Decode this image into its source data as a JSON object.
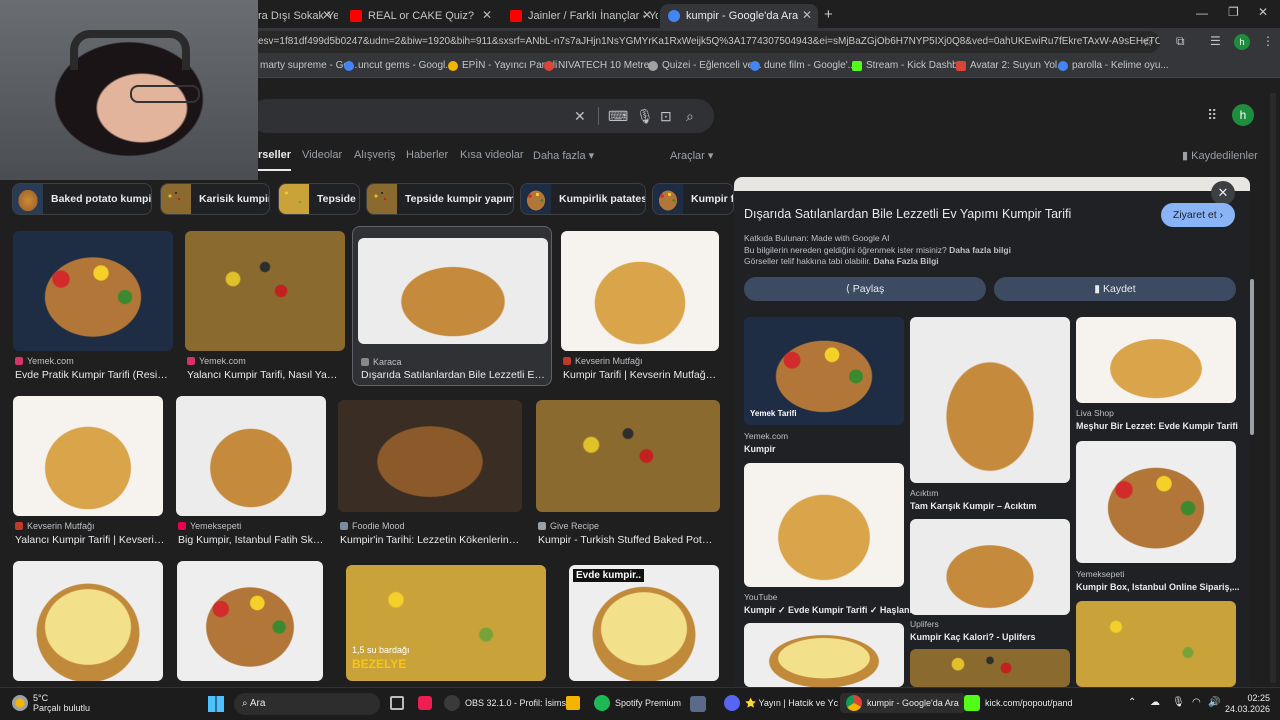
{
  "browser": {
    "tabs": [
      {
        "label": "ra Dışı Sokak Ye",
        "icon_color": "#ff0000"
      },
      {
        "label": "REAL or CAKE Quiz?",
        "icon_color": "#ff0000"
      },
      {
        "label": "Jainler / Farklı İnançlar - YouTube",
        "icon_color": "#ff0000"
      },
      {
        "label": "kumpir - Google'da Ara",
        "icon_color": "#4285f4"
      }
    ],
    "new_tab": "+",
    "url": "esv=1f81df499d5b0247&udm=2&biw=1920&bih=911&sxsrf=ANbL-n7s7aJHjn1NsYGMYrKa1RxWeijk5Q%3A1774307504943&ei=sMjBaZGjOb6H7NYP5IXj0Q8&ved=0ahUKEwiRu7fEkreTAxW-A9sEHeTCPoQ4dU...",
    "profile": "h",
    "bookmarks": [
      {
        "label": "marty supreme - Go...",
        "color": "#4285f4"
      },
      {
        "label": "uncut gems - Googl...",
        "color": "#4285f4"
      },
      {
        "label": "EPİN - Yayıncı Paneli",
        "color": "#f4b400"
      },
      {
        "label": "NIVATECH 10 Metre...",
        "color": "#db4437"
      },
      {
        "label": "Quizei - Eğlenceli ve...",
        "color": "#a0a0a0"
      },
      {
        "label": "dune film - Google'...",
        "color": "#4285f4"
      },
      {
        "label": "Stream - Kick Dashb...",
        "color": "#53fc18"
      },
      {
        "label": "Avatar 2: Suyun Yol...",
        "color": "#db4437"
      },
      {
        "label": "parolla - Kelime oyu...",
        "color": "#4285f4"
      }
    ]
  },
  "google": {
    "profile": "h",
    "nav": [
      "rseller",
      "Videolar",
      "Alışveriş",
      "Haberler",
      "Kısa videolar",
      "Daha fazla",
      "Araçlar",
      "Kaydedilenler"
    ],
    "chips": [
      "Baked potato kumpir",
      "Karisik kumpir",
      "Tepside",
      "Tepside kumpir yapımı",
      "Kumpirlik patates",
      "Kumpir fi"
    ],
    "results": [
      {
        "source": "Yemek.com",
        "title": "Evde Pratik Kumpir Tarifi (Resimli...",
        "fav": "#d6336c"
      },
      {
        "source": "Yemek.com",
        "title": "Yalancı Kumpir Tarifi, Nasıl Yapılı...",
        "fav": "#d6336c"
      },
      {
        "source": "Karaca",
        "title": "Dışarıda Satılanlardan Bile Lezzetli Ev Y...",
        "fav": "#888888"
      },
      {
        "source": "Kevserin Mutfağı",
        "title": "Kumpir Tarifi | Kevserin Mutfağı - ...",
        "fav": "#c0392b"
      },
      {
        "source": "Kevserin Mutfağı",
        "title": "Yalancı Kumpir Tarifi | Kevserin...",
        "fav": "#c0392b"
      },
      {
        "source": "Yemeksepeti",
        "title": "Big Kumpir, Istanbul Fatih Sk. ...",
        "fav": "#ea004b"
      },
      {
        "source": "Foodie Mood",
        "title": "Kumpir'in Tarihi: Lezzetin Kökenlerinde...",
        "fav": "#7a8ca0"
      },
      {
        "source": "Give Recipe",
        "title": "Kumpir - Turkish Stuffed Baked Potatoe...",
        "fav": "#9aa0a6"
      }
    ],
    "overlay_texts": {
      "bezelye_1": "1,5 su bardağı",
      "bezelye_2": "BEZELYE",
      "evde": "Evde kumpir.."
    }
  },
  "panel": {
    "title": "Dışarıda Satılanlardan Bile Lezzetli Ev Yapımı Kumpir Tarifi",
    "visit": "Ziyaret et",
    "credit": "Katkıda Bulunan: Made with Google AI",
    "info1": "Bu bilgilerin nereden geldiğini öğrenmek ister misiniz?",
    "info1_link": "Daha fazla bilgi",
    "info2": "Görseller telif hakkına tabi olabilir.",
    "info2_link": "Daha Fazla Bilgi",
    "share": "Paylaş",
    "save": "Kaydet",
    "related": [
      {
        "badge": "Yemek Tarifi",
        "source": "Yemek.com",
        "title": "Kumpir",
        "fav": "#d6336c"
      },
      {
        "source": "Acıktım",
        "title": "Tam Karışık Kumpir – Acıktım",
        "fav": "#888888"
      },
      {
        "source": "Liva Shop",
        "title": "Meşhur Bir Lezzet: Evde Kumpir Tarifi",
        "fav": "#cccccc"
      },
      {
        "source": "YouTube",
        "title": "Kumpir ✓ Evde Kumpir Tarifi ✓ Haşlanm...",
        "fav": "#ff0000"
      },
      {
        "source": "Uplifers",
        "title": "Kumpir Kaç Kalori? - Uplifers",
        "fav": "#4285f4"
      },
      {
        "source": "Yemeksepeti",
        "title": "Kumpir Box, Istanbul Online Sipariş,...",
        "fav": "#ea004b"
      }
    ]
  },
  "taskbar": {
    "weather_temp": "5°C",
    "weather_desc": "Parçalı bulutlu",
    "search": "Ara",
    "apps": [
      {
        "label": "OBS 32.1.0 - Profil: İsims",
        "color": "#3a3a3a"
      },
      {
        "label": "Spotify Premium",
        "color": "#1db954"
      },
      {
        "label": "⭐ Yayın | Hatcik ve Yc",
        "color": "#5865f2"
      },
      {
        "label": "kumpir - Google'da Ara",
        "color": "#4285f4"
      },
      {
        "label": "kick.com/popout/pand",
        "color": "#53fc18"
      }
    ],
    "time": "02:25",
    "date": "24.03.2026"
  }
}
